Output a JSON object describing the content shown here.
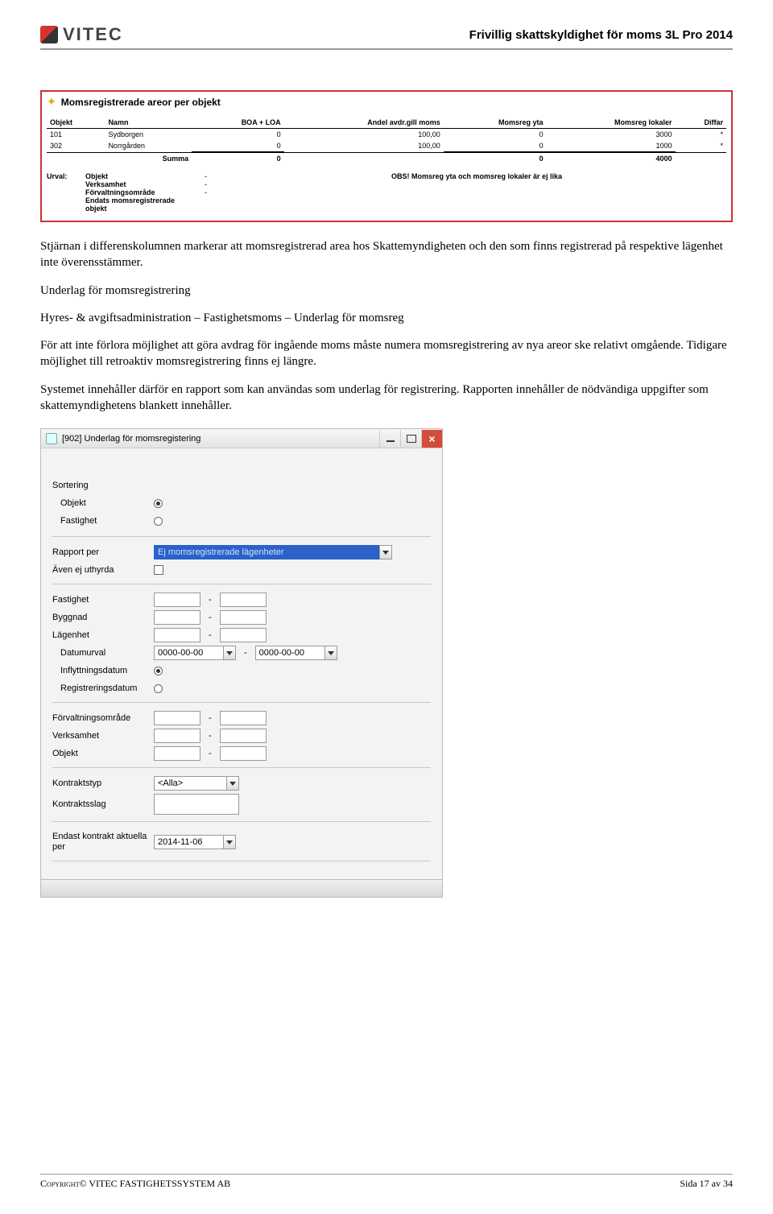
{
  "header": {
    "logo_text": "VITEC",
    "doc_title": "Frivillig skattskyldighet för moms 3L Pro 2014"
  },
  "report1": {
    "icon": "star-icon",
    "title": "Momsregistrerade areor per objekt",
    "columns": [
      "Objekt",
      "Namn",
      "BOA + LOA",
      "Andel avdr.gill moms",
      "Momsreg yta",
      "Momsreg lokaler",
      "Diffar"
    ],
    "rows": [
      {
        "objekt": "101",
        "namn": "Sydborgen",
        "boa": "0",
        "andel": "100,00",
        "yta": "0",
        "lok": "3000",
        "diff": "*"
      },
      {
        "objekt": "302",
        "namn": "Norrgården",
        "boa": "0",
        "andel": "100,00",
        "yta": "0",
        "lok": "1000",
        "diff": "*"
      }
    ],
    "sum_label": "Summa",
    "sum": {
      "boa": "0",
      "yta": "0",
      "lok": "4000"
    },
    "urval_label": "Urval:",
    "urval": [
      {
        "k": "Objekt",
        "v": "-"
      },
      {
        "k": "Verksamhet",
        "v": "-"
      },
      {
        "k": "Förvaltningsområde",
        "v": "-"
      },
      {
        "k": "Endats momsregistrerade objekt",
        "v": ""
      }
    ],
    "obs": "OBS! Momsreg yta och momsreg lokaler är ej lika"
  },
  "paragraphs": {
    "p1": "Stjärnan i differenskolumnen markerar att momsregistrerad area hos Skattemyndigheten och den som finns registrerad på respektive lägenhet inte överensstämmer.",
    "h2line1": "Underlag för momsregistrering",
    "h2line2": "Hyres- & avgiftsadministration – Fastighetsmoms – Underlag för momsreg",
    "p3": "För att inte förlora möjlighet att göra avdrag för ingående moms måste numera momsregistrering av nya areor ske relativt omgående. Tidigare möjlighet till retroaktiv momsregistrering finns ej längre.",
    "p4": "Systemet innehåller därför en rapport som kan användas som underlag för registrering. Rapporten innehåller de nödvändiga uppgifter som skattemyndighetens blankett innehåller."
  },
  "dialog": {
    "caption": "[902]  Underlag för momsregistering",
    "labels": {
      "sortering": "Sortering",
      "objekt": "Objekt",
      "fastighet": "Fastighet",
      "rapport_per": "Rapport per",
      "rapport_per_value": "Ej momsregistrerade lägenheter",
      "aven": "Även ej uthyrda",
      "fastighet2": "Fastighet",
      "byggnad": "Byggnad",
      "lagenhet": "Lägenhet",
      "datumurval": "Datumurval",
      "date_from": "0000-00-00",
      "date_to": "0000-00-00",
      "inflytt": "Inflyttningsdatum",
      "regdatum": "Registreringsdatum",
      "forvaltning": "Förvaltningsområde",
      "verksamhet": "Verksamhet",
      "objekt2": "Objekt",
      "kontraktstyp": "Kontraktstyp",
      "kontraktstyp_value": "<Alla>",
      "kontraktsslag": "Kontraktsslag",
      "endast": "Endast kontrakt aktuella per",
      "endast_date": "2014-11-06"
    }
  },
  "footer": {
    "copyright": "Copyright© VITEC FASTIGHETSSYSTEM AB",
    "page": "Sida 17 av 34"
  }
}
